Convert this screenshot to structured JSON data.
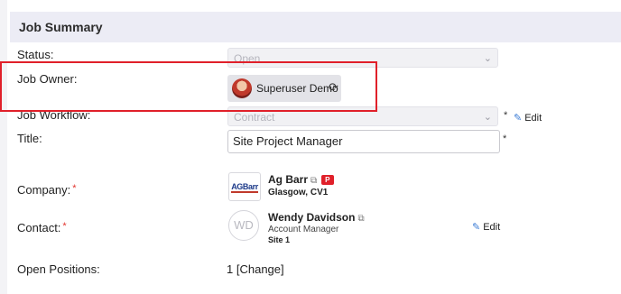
{
  "section": {
    "title": "Job Summary"
  },
  "fields": {
    "status": {
      "label": "Status:",
      "value": "Open"
    },
    "job_owner": {
      "label": "Job Owner:",
      "name": "Superuser Demo"
    },
    "job_workflow": {
      "label": "Job Workflow:",
      "value": "Contract",
      "required_mark": "*",
      "edit_label": "Edit"
    },
    "title": {
      "label": "Title:",
      "value": "Site Project Manager",
      "required_mark": "*"
    },
    "company": {
      "label": "Company:",
      "required_mark": "*",
      "logo_text": "AGBarr",
      "name": "Ag Barr",
      "badge": "P",
      "location": "Glasgow, CV1"
    },
    "contact": {
      "label": "Contact:",
      "required_mark": "*",
      "initials": "WD",
      "name": "Wendy Davidson",
      "role": "Account Manager",
      "site": "Site 1",
      "edit_label": "Edit"
    },
    "open_positions": {
      "label": "Open Positions:",
      "count": "1",
      "change_label": "[Change]"
    }
  },
  "icons": {
    "chevron": "chevron-down-icon",
    "refresh": "refresh-icon",
    "pencil": "pencil-icon",
    "external": "external-link-icon"
  },
  "colors": {
    "highlight": "#e0202a",
    "header_bg": "#ececf5",
    "link": "#3a7bd5",
    "badge": "#e0202a"
  }
}
